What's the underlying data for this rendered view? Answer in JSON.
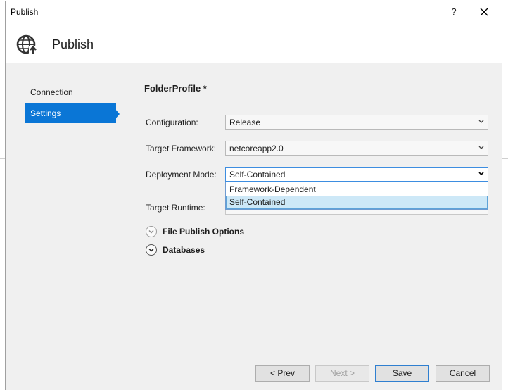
{
  "window": {
    "title": "Publish",
    "help_label": "?",
    "close_label": "✕"
  },
  "header": {
    "icon": "globe-publish-icon",
    "title": "Publish"
  },
  "nav": {
    "items": [
      {
        "label": "Connection",
        "selected": false
      },
      {
        "label": "Settings",
        "selected": true
      }
    ],
    "accent_color": "#0a76d6"
  },
  "profile": {
    "title": "FolderProfile *"
  },
  "form": {
    "configuration": {
      "label": "Configuration:",
      "value": "Release"
    },
    "target_framework": {
      "label": "Target Framework:",
      "value": "netcoreapp2.0"
    },
    "deployment_mode": {
      "label": "Deployment Mode:",
      "value": "Self-Contained",
      "options": [
        "Framework-Dependent",
        "Self-Contained"
      ],
      "selected_option": "Self-Contained"
    },
    "target_runtime": {
      "label": "Target Runtime:"
    }
  },
  "expanders": [
    {
      "label": "File Publish Options",
      "icon": "chevron-down-circle-icon"
    },
    {
      "label": "Databases",
      "icon": "chevron-down-circle-icon"
    }
  ],
  "buttons": {
    "prev": "< Prev",
    "next": "Next >",
    "save": "Save",
    "cancel": "Cancel"
  }
}
